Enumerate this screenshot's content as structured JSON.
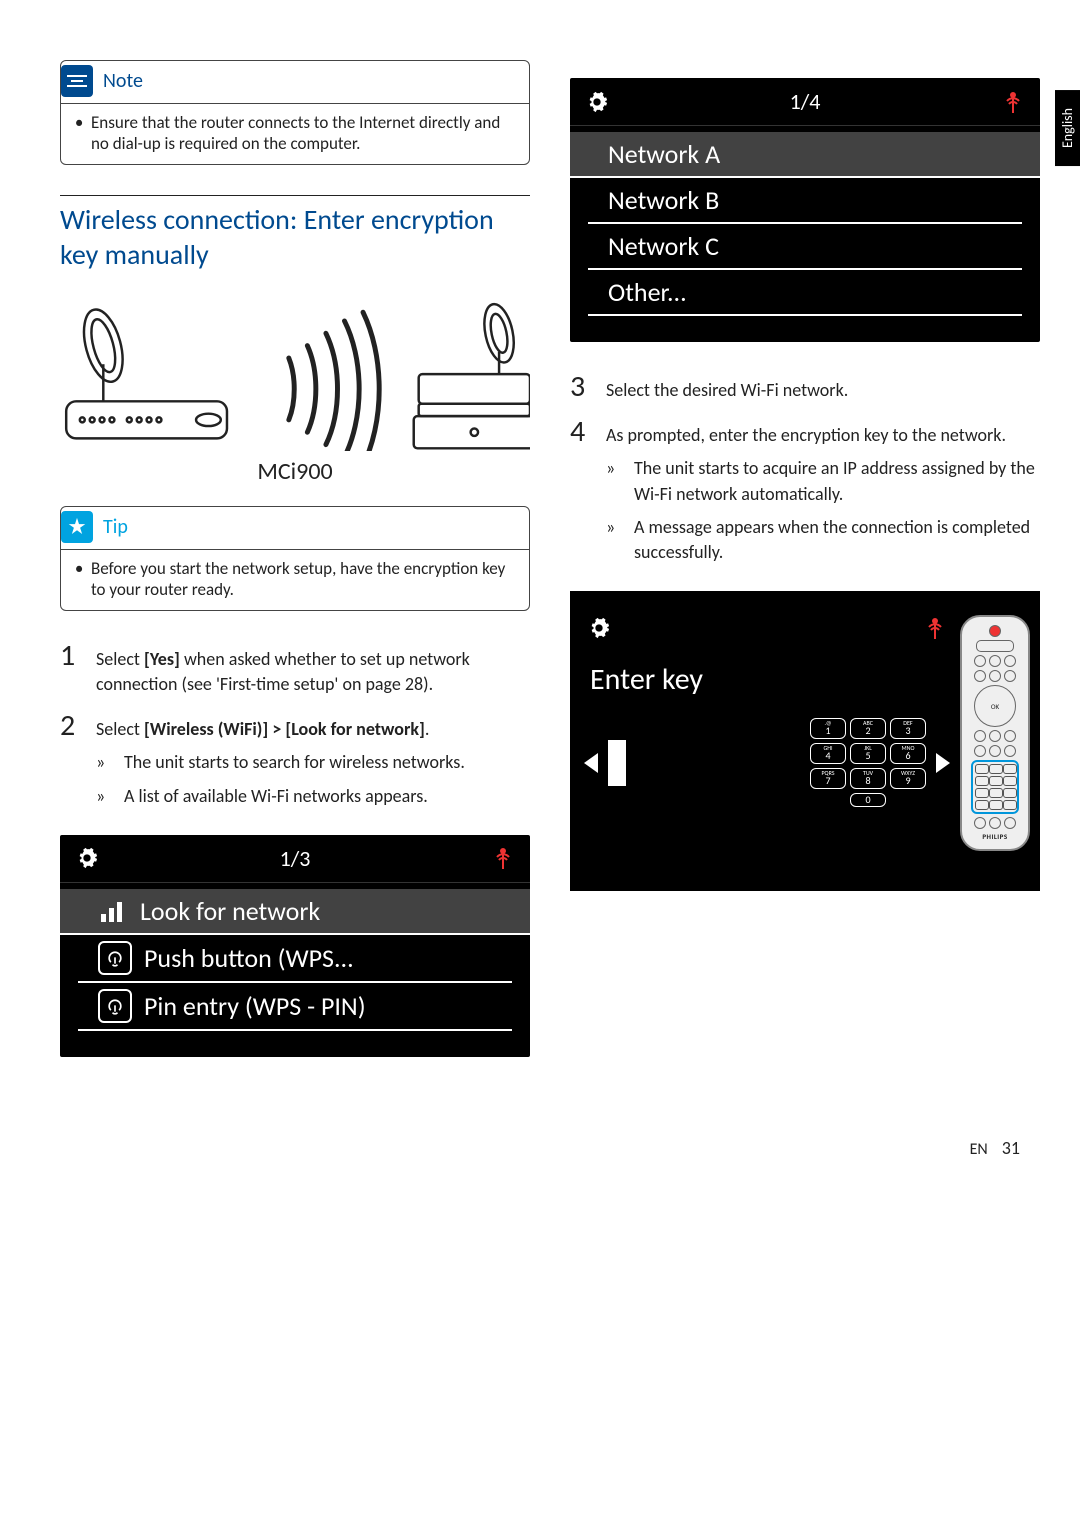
{
  "lang_tab": "English",
  "note": {
    "title": "Note",
    "body": "Ensure that the router connects to the Internet directly and no dial-up is required on the computer."
  },
  "section_heading": "Wireless connection: Enter encryption key manually",
  "device_label": "MCi900",
  "tip": {
    "title": "Tip",
    "body": "Before you start the network setup, have the encryption key to your router ready."
  },
  "steps_left": [
    {
      "num": "1",
      "text_pre": "Select ",
      "bold": "[Yes]",
      "text_post": " when asked whether to set up network connection (see 'First-time setup' on page 28)."
    },
    {
      "num": "2",
      "text_pre": "Select ",
      "bold": "[Wireless (WiFi)] > [Look for network]",
      "text_post": ".",
      "subs": [
        "The unit starts to search for wireless networks.",
        "A list of available Wi-Fi networks appears."
      ]
    }
  ],
  "screen1": {
    "counter": "1/3",
    "items": [
      {
        "icon": "bars",
        "label": "Look for network",
        "selected": true
      },
      {
        "icon": "wps",
        "label": "Push button (WPS...",
        "selected": false
      },
      {
        "icon": "wps",
        "label": "Pin entry (WPS - PIN)",
        "selected": false
      }
    ]
  },
  "screen2": {
    "counter": "1/4",
    "items": [
      {
        "label": "Network A",
        "selected": true
      },
      {
        "label": "Network B",
        "selected": false
      },
      {
        "label": "Network C",
        "selected": false
      },
      {
        "label": "Other...",
        "selected": false
      }
    ]
  },
  "steps_right": [
    {
      "num": "3",
      "text": "Select the desired Wi-Fi network."
    },
    {
      "num": "4",
      "text": "As prompted, enter the encryption key to the network.",
      "subs": [
        "The unit starts to acquire an IP address assigned by the Wi-Fi network automatically.",
        "A message appears when the connection is completed successfully."
      ]
    }
  ],
  "enterkey": {
    "title": "Enter key",
    "keys": [
      {
        "sup": ".@",
        "n": "1"
      },
      {
        "sup": "ABC",
        "n": "2"
      },
      {
        "sup": "DEF",
        "n": "3"
      },
      {
        "sup": "GHI",
        "n": "4"
      },
      {
        "sup": "JKL",
        "n": "5"
      },
      {
        "sup": "MNO",
        "n": "6"
      },
      {
        "sup": "PQRS",
        "n": "7"
      },
      {
        "sup": "TUV",
        "n": "8"
      },
      {
        "sup": "WXYZ",
        "n": "9"
      },
      {
        "sup": "",
        "n": "0"
      }
    ],
    "remote_brand": "PHILIPS"
  },
  "footer": {
    "lang": "EN",
    "page": "31"
  }
}
